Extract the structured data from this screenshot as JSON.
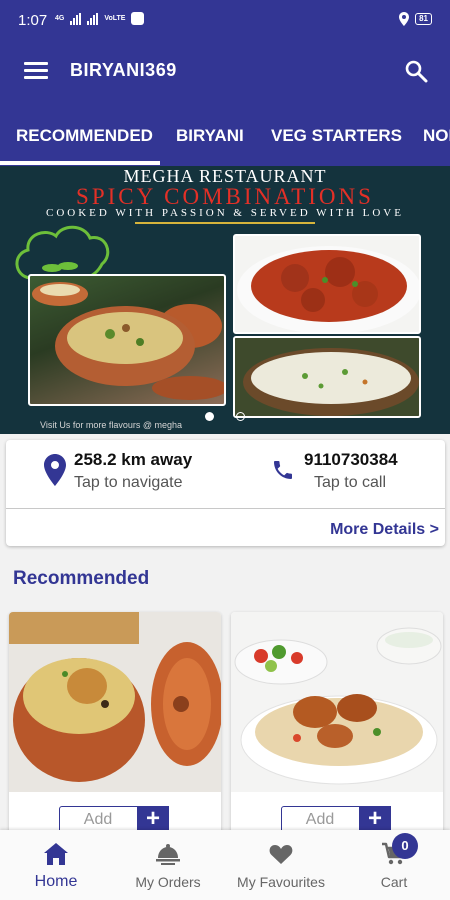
{
  "status_bar": {
    "time": "1:07",
    "network_label": "4G",
    "volte_label": "VoLTE",
    "battery": "81"
  },
  "app_bar": {
    "title": "BIRYANI369"
  },
  "tabs": [
    {
      "label": "RECOMMENDED"
    },
    {
      "label": "BIRYANI"
    },
    {
      "label": "VEG STARTERS"
    },
    {
      "label": "NON"
    }
  ],
  "banner": {
    "title": "MEGHA RESTAURANT",
    "subtitle": "SPICY COMBINATIONS",
    "tagline": "COOKED WITH PASSION & SERVED WITH LOVE",
    "footer": "Visit Us for more flavours @ megha"
  },
  "info_card": {
    "distance": "258.2 km away",
    "navigate_hint": "Tap to navigate",
    "phone": "9110730384",
    "call_hint": "Tap to call",
    "more_details": "More Details >"
  },
  "section_title": "Recommended",
  "products": [
    {
      "add_label": "Add",
      "plus_label": "+"
    },
    {
      "add_label": "Add",
      "plus_label": "+"
    }
  ],
  "bottom_nav": [
    {
      "label": "Home",
      "icon": "home-icon"
    },
    {
      "label": "My Orders",
      "icon": "serving-dish-icon"
    },
    {
      "label": "My Favourites",
      "icon": "heart-icon"
    },
    {
      "label": "Cart",
      "icon": "cart-icon"
    }
  ],
  "cart_count": "0",
  "colors": {
    "primary": "#333694",
    "banner_red": "#e33027",
    "background": "#f2f2f2"
  }
}
